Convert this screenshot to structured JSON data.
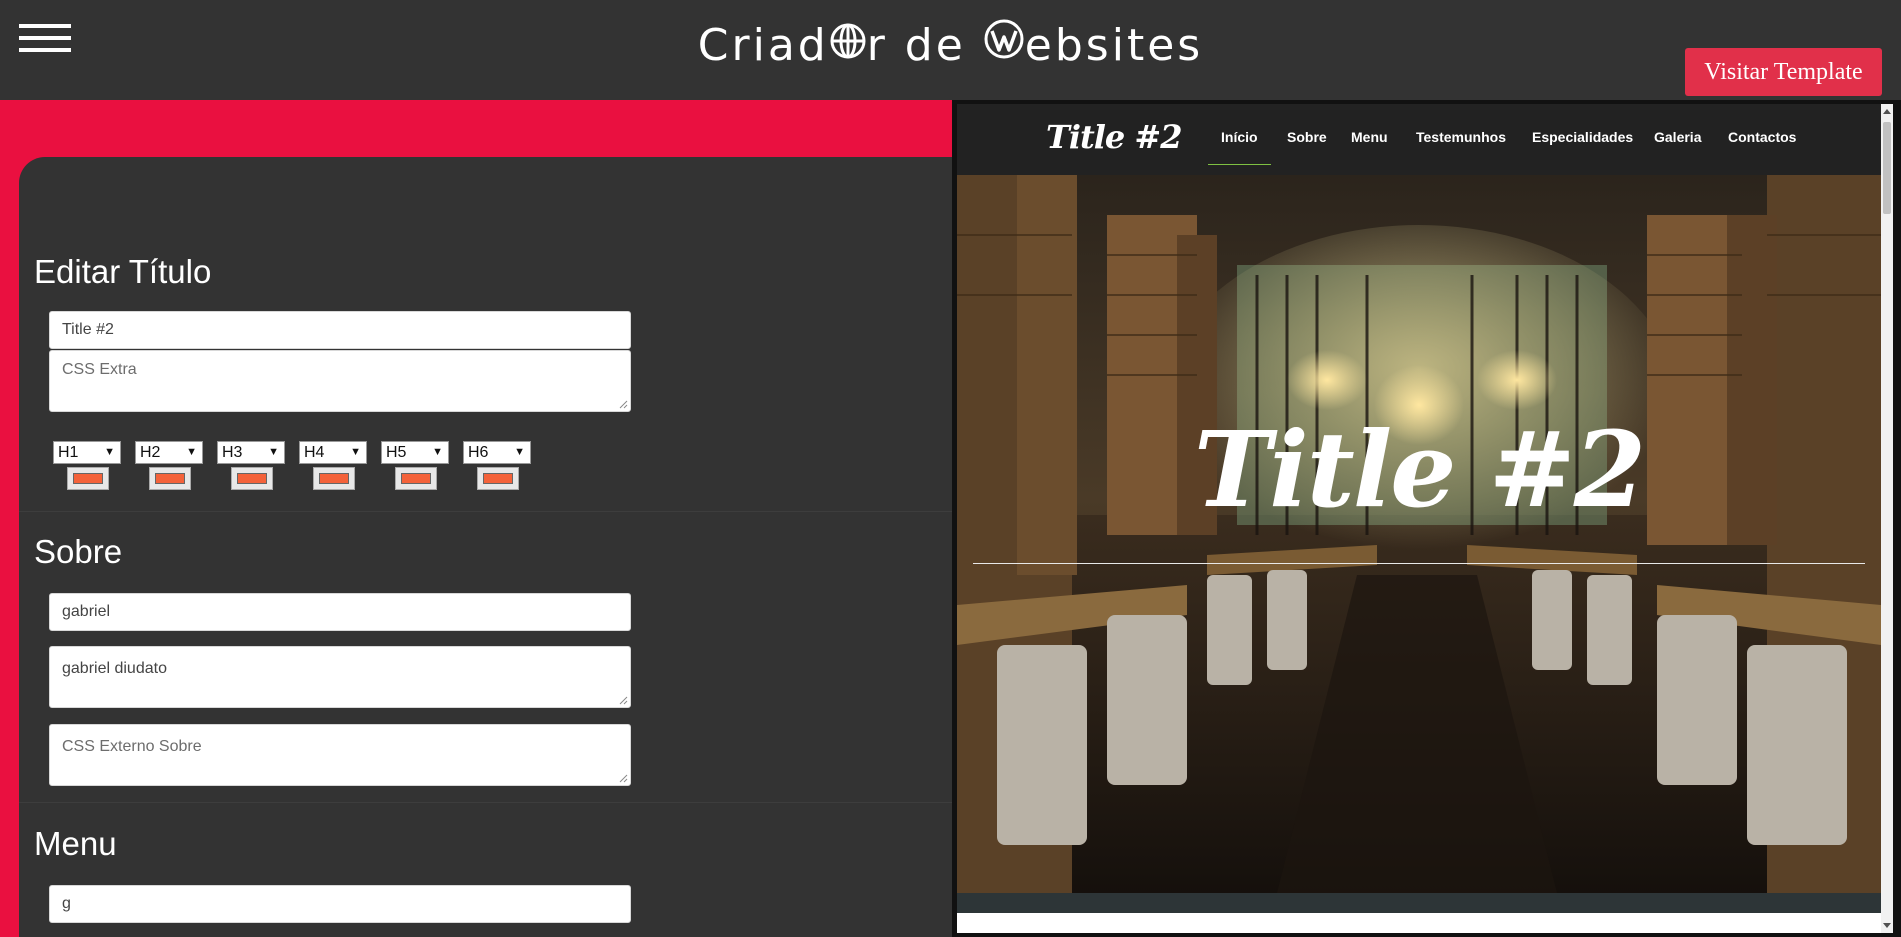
{
  "header": {
    "brand_part1": "Criad",
    "brand_part2": "r de ",
    "brand_part3": "ebsites",
    "visit_label": "Visitar Template"
  },
  "editor": {
    "title_section": {
      "heading": "Editar Título",
      "title_value": "Title #2",
      "css_placeholder": "CSS Extra",
      "heading_selects": [
        "H1",
        "H2",
        "H3",
        "H4",
        "H5",
        "H6"
      ],
      "swatch_color": "#f4623a"
    },
    "about_section": {
      "heading": "Sobre",
      "name_value": "gabriel",
      "text_value": "gabriel diudato",
      "css_placeholder": "CSS Externo Sobre"
    },
    "menu_section": {
      "heading": "Menu",
      "first_value": "g"
    }
  },
  "preview": {
    "logo": "Title #2",
    "nav": [
      "Início",
      "Sobre",
      "Menu",
      "Testemunhos",
      "Especialidades",
      "Galeria",
      "Contactos"
    ],
    "active_nav": "Início",
    "hero_title": "Title #2"
  },
  "colors": {
    "accent": "#ea1040",
    "button": "#e1304a",
    "panel": "#333333",
    "nav_active_underline": "#7fc142"
  }
}
